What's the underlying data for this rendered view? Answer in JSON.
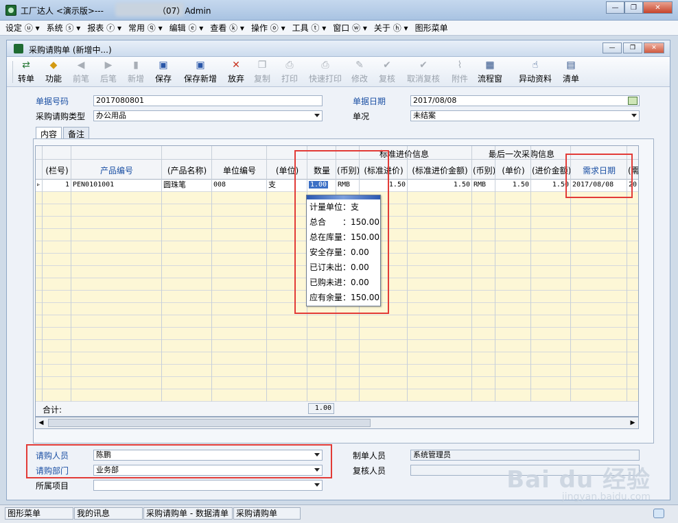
{
  "window": {
    "title_prefix": "工厂达人 <演示版>---",
    "title_suffix": "（07）Admin"
  },
  "menu": [
    "设定 ⓤ ▾",
    "系统 ⓢ ▾",
    "报表 ⓡ ▾",
    "常用 ⓠ ▾",
    "编辑 ⓔ ▾",
    "查看 ⓚ ▾",
    "操作 ⓞ ▾",
    "工具 ⓣ ▾",
    "窗口 ⓦ ▾",
    "关于 ⓗ ▾",
    "图形菜单"
  ],
  "child": {
    "title": "采购请购单 (新增中...)"
  },
  "toolbar": [
    {
      "label": "转单",
      "icon": "⇄",
      "enabled": true
    },
    {
      "label": "功能",
      "icon": "◆",
      "enabled": true
    },
    {
      "label": "前笔",
      "icon": "◀",
      "enabled": false
    },
    {
      "label": "后笔",
      "icon": "▶",
      "enabled": false
    },
    {
      "label": "新增",
      "icon": "▮",
      "enabled": false
    },
    {
      "label": "保存",
      "icon": "▣",
      "enabled": true
    },
    {
      "label": "保存新增",
      "icon": "▣",
      "enabled": true
    },
    {
      "label": "放弃",
      "icon": "✕",
      "enabled": true
    },
    {
      "label": "复制",
      "icon": "❐",
      "enabled": false
    },
    {
      "label": "打印",
      "icon": "⎙",
      "enabled": false
    },
    {
      "label": "快速打印",
      "icon": "⎙",
      "enabled": false
    },
    {
      "label": "修改",
      "icon": "✎",
      "enabled": false
    },
    {
      "label": "复核",
      "icon": "✔",
      "enabled": false
    },
    {
      "label": "取消复核",
      "icon": "✔",
      "enabled": false
    },
    {
      "label": "附件",
      "icon": "⌇",
      "enabled": false
    },
    {
      "label": "流程窗",
      "icon": "▦",
      "enabled": true
    },
    {
      "label": "异动资料",
      "icon": "☝",
      "enabled": true
    },
    {
      "label": "清单",
      "icon": "▤",
      "enabled": true
    }
  ],
  "form": {
    "doc_no_label": "单据号码",
    "doc_no": "2017080801",
    "type_label": "采购请购类型",
    "type_value": "办公用品",
    "date_label": "单据日期",
    "date_value": "2017/08/08",
    "status_label": "单况",
    "status_value": "未结案"
  },
  "tabs": [
    "内容",
    "备注"
  ],
  "grid": {
    "group_std": "标准进价信息",
    "group_last": "最后一次采购信息",
    "headers": {
      "row_no": "(栏号)",
      "product_code": "产品编号",
      "product_name": "(产品名称)",
      "unit_code": "单位编号",
      "unit": "(单位)",
      "qty": "数量",
      "currency1": "(币别)",
      "std_price": "(标准进价)",
      "std_amount": "(标准进价金额)",
      "currency2": "(币别)",
      "unit_price": "(单价)",
      "last_amount": "(进价金额)",
      "need_date": "需求日期",
      "extra": "(需期)"
    },
    "rows": [
      {
        "row_no": "1",
        "product_code": "PEN0101001",
        "product_name": "圆珠笔",
        "unit_code": "008",
        "unit": "支",
        "qty": "1.00",
        "currency1": "RMB",
        "std_price": "1.50",
        "std_amount": "1.50",
        "currency2": "RMB",
        "unit_price": "1.50",
        "last_amount": "1.50",
        "need_date": "2017/08/08",
        "extra": "20"
      }
    ],
    "total_label": "合计:",
    "total_qty": "1.00"
  },
  "popup": {
    "lines": [
      "计量单位：支",
      "总合　　：150.00",
      "总在库量：150.00",
      "安全存量：0.00",
      "已订未出：0.00",
      "已购未进：0.00",
      "应有余量：150.00"
    ]
  },
  "footer_form": {
    "requester_label": "请购人员",
    "requester_value": "陈鹏",
    "dept_label": "请购部门",
    "dept_value": "业务部",
    "project_label": "所属项目",
    "project_value": "",
    "maker_label": "制单人员",
    "maker_value": "系统管理员",
    "reviewer_label": "复核人员",
    "reviewer_value": ""
  },
  "statusbar": [
    "图形菜单",
    "我的讯息",
    "采购请购单 - 数据清单",
    "采购请购单"
  ],
  "watermark": {
    "main": "Bai du 经验",
    "sub": "jingyan.baidu.com"
  },
  "colors": {
    "accent_blue": "#1a4fa3",
    "highlight_red": "#e23a36",
    "alt_row": "#fdf7d6"
  }
}
